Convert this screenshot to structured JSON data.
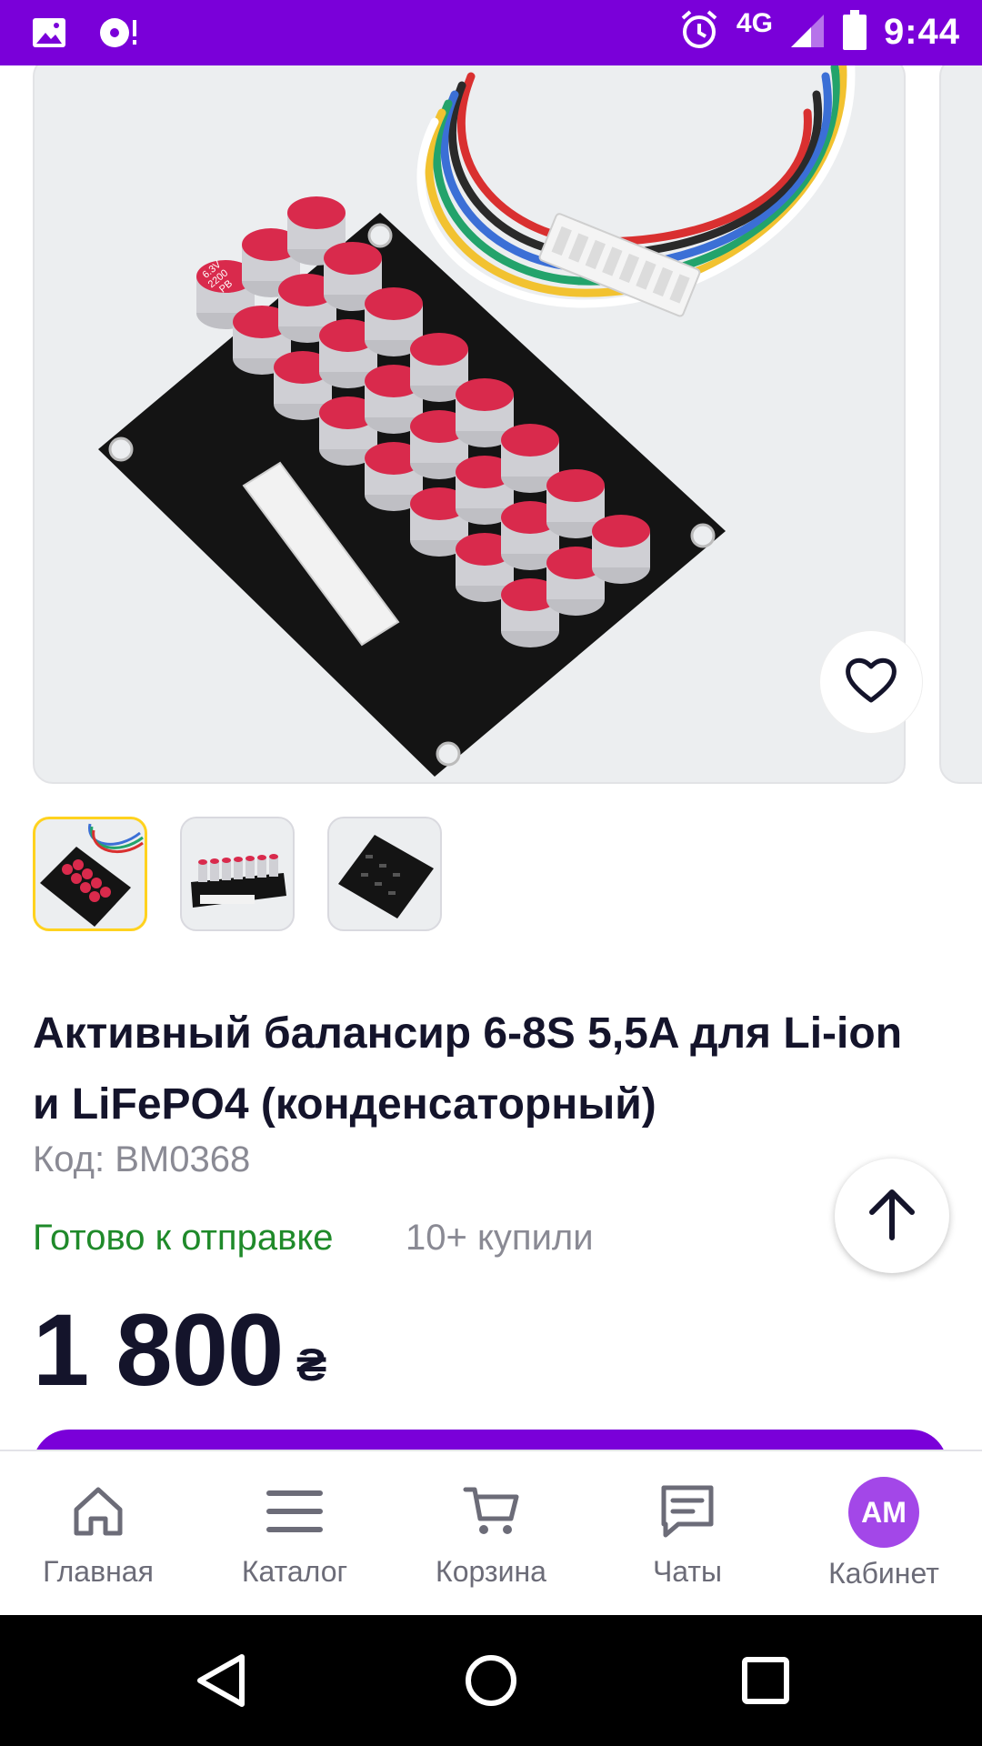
{
  "status_bar": {
    "network": "4G",
    "time": "9:44"
  },
  "product": {
    "title": "Активный балансир 6-8S 5,5A для Li-ion и LiFePO4 (конденсаторный)",
    "code": "Код: BM0368",
    "availability": "Готово к отправке",
    "sold_count": "10+ купили",
    "price": "1 800",
    "currency": "₴",
    "thumbnails": [
      {
        "active": true
      },
      {
        "active": false
      },
      {
        "active": false
      }
    ]
  },
  "capacitor_label": {
    "line1": "6.3V",
    "line2": "2200",
    "line3": "PB"
  },
  "bottom_nav": {
    "items": [
      {
        "label": "Главная",
        "icon": "home-icon"
      },
      {
        "label": "Каталог",
        "icon": "menu-icon"
      },
      {
        "label": "Корзина",
        "icon": "cart-icon"
      },
      {
        "label": "Чаты",
        "icon": "chat-icon"
      },
      {
        "label": "Кабинет",
        "icon": "avatar"
      }
    ],
    "avatar_initials": "AM"
  },
  "colors": {
    "brand": "#7a00d9",
    "in_stock": "#1f8a2a",
    "thumb_active_border": "#ffd21f",
    "avatar": "#a347e8"
  }
}
